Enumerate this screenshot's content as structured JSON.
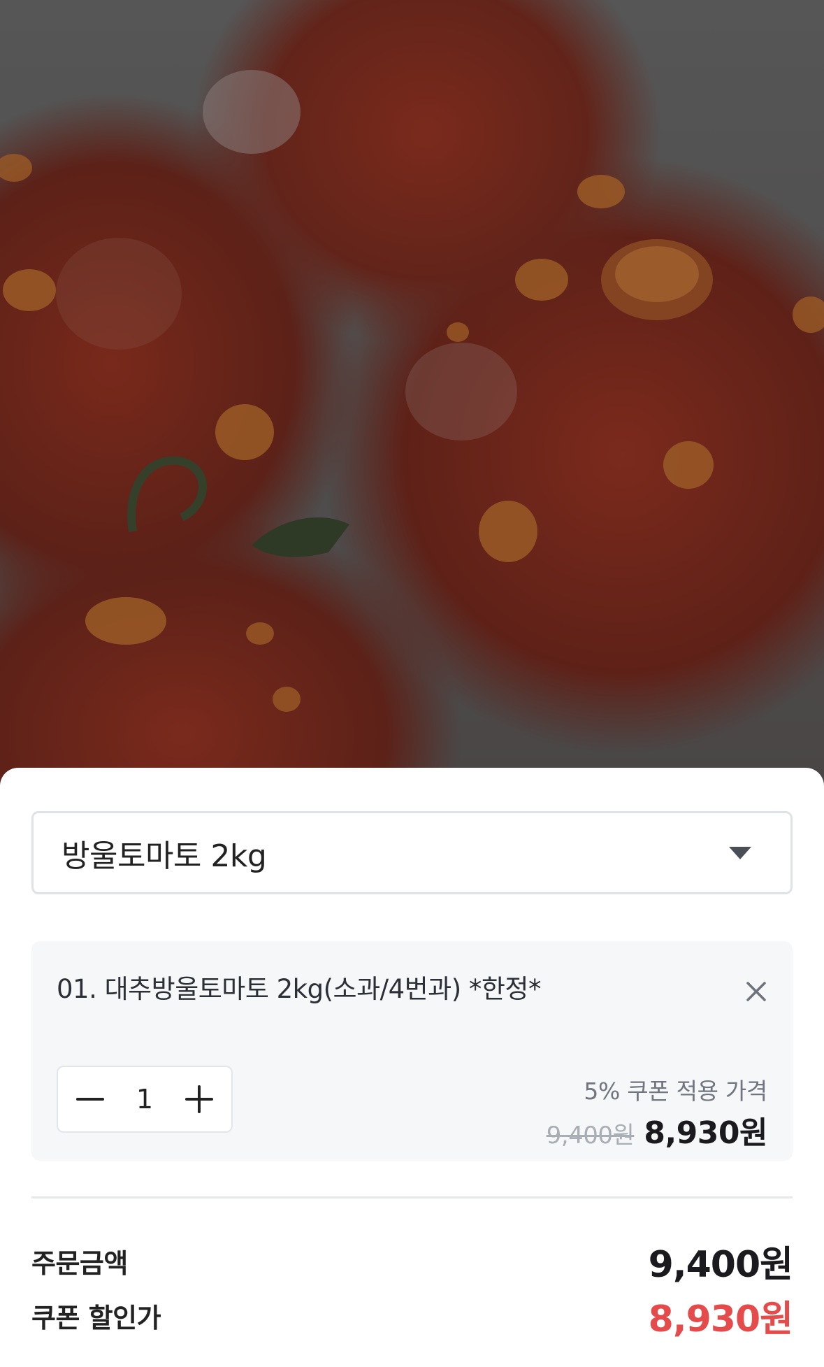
{
  "product_image": {
    "icon": "tomato-photo",
    "alt_subject": ""
  },
  "option_select": {
    "selected": "방울토마토 2kg",
    "icon": "caret-down-icon"
  },
  "selected_item": {
    "name": "01. 대추방울토마토 2kg(소과/4번과) *한정*",
    "remove_icon": "close-icon",
    "quantity": "1",
    "decrease_icon": "minus-icon",
    "increase_icon": "plus-icon",
    "coupon_note": "5% 쿠폰 적용 가격",
    "original_price": "9,400원",
    "discounted_price": "8,930원"
  },
  "summary": {
    "order_amount_label": "주문금액",
    "order_amount_value": "9,400원",
    "coupon_price_label": "쿠폰 할인가",
    "coupon_price_value": "8,930원"
  },
  "colors": {
    "accent_red": "#e54b4b",
    "card_bg": "#f6f7f9",
    "border": "#dfe2e7"
  }
}
